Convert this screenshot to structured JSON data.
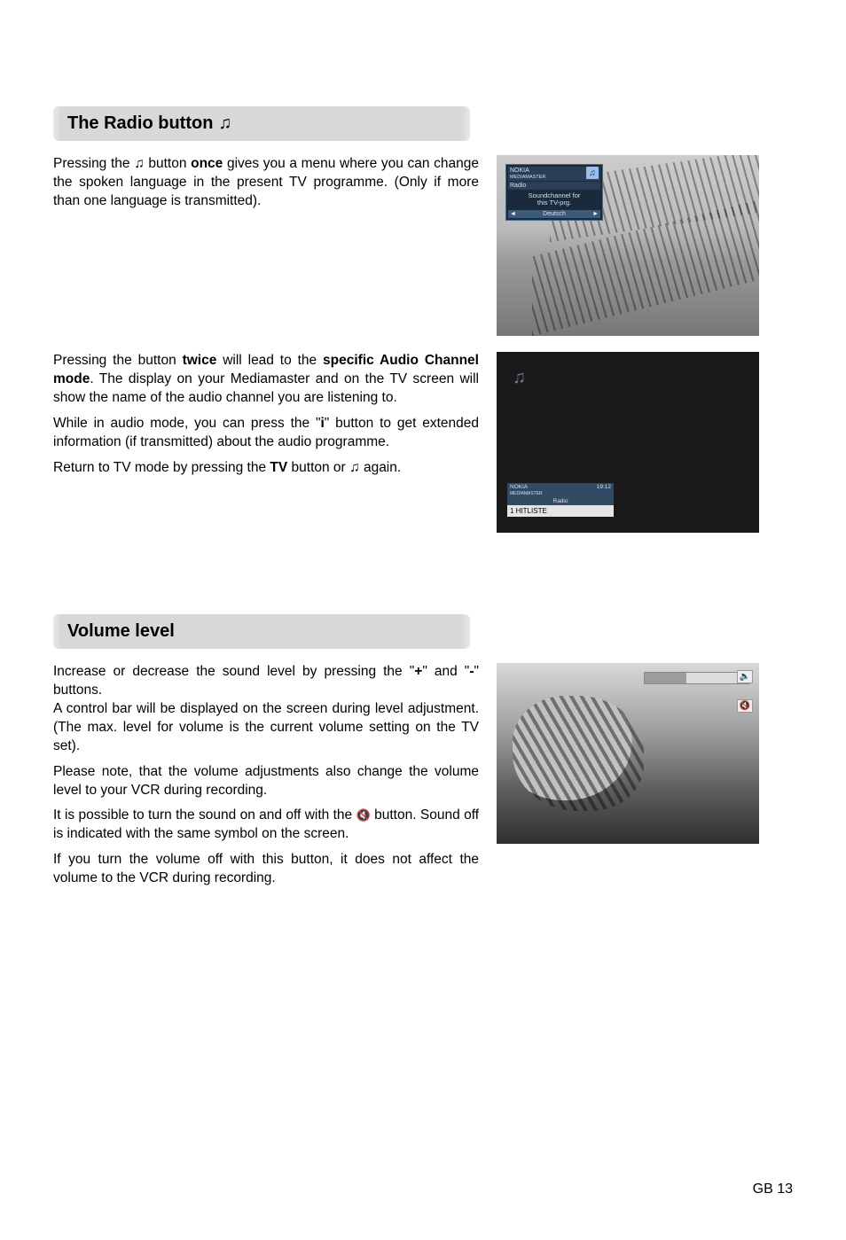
{
  "sections": {
    "radio": {
      "heading": "The Radio button",
      "icon": "♫",
      "p1_a": "Pressing the ",
      "p1_icon": "♫",
      "p1_b": " button ",
      "p1_bold": "once",
      "p1_c": " gives you a menu where you can change the spoken language in the present TV programme. (Only if more than one language is transmitted).",
      "p2_a": "Pressing the button ",
      "p2_b1": "twice",
      "p2_b": " will lead to the ",
      "p2_b2": "specific Audio Channel mode",
      "p2_c": ". The display on your Mediamaster and on the TV screen will show the name of the audio channel you are listening to.",
      "p3_a": "While in audio mode, you can press the \"",
      "p3_i": "i",
      "p3_b": "\" button to get extended information (if transmitted) about the audio programme.",
      "p4_a": "Return to TV mode by pressing the ",
      "p4_tv": "TV",
      "p4_b": " button or ",
      "p4_icon": "♫",
      "p4_c": " again."
    },
    "volume": {
      "heading": "Volume level",
      "p1_a": "Increase or decrease the sound level by pressing the \"",
      "p1_plus": "+",
      "p1_b": "\" and \"",
      "p1_minus": "-",
      "p1_c": "\" buttons.",
      "p2": "A control bar will be displayed on the screen during level adjustment. (The max. level for volume is the current volume setting on the TV set).",
      "p3": "Please note, that the volume adjustments also change the volume level to your VCR during recording.",
      "p4_a": "It is possible to turn the sound on and off with the ",
      "p4_icon": "🔇",
      "p4_b": " button. Sound off is indicated with the same symbol on the screen.",
      "p5": "If you turn the volume off with this button, it does not affect the volume to the VCR during recording."
    }
  },
  "osd1": {
    "brand": "NOKIA",
    "brand_sub": "MEDIAMASTER",
    "menu_label": "Radio",
    "note1": "Soundchannel for",
    "note2": "this TV-prg.",
    "lang": "Deutsch",
    "left": "◄",
    "right": "►"
  },
  "osd2": {
    "icon": "♫",
    "brand": "NOKIA",
    "brand_sub": "MEDIAMASTER",
    "time": "19:12",
    "label": "Radio",
    "station": "1 HITLISTE"
  },
  "osd3": {
    "vol_icon": "🔈",
    "mute_icon": "🔇"
  },
  "page": "GB 13"
}
